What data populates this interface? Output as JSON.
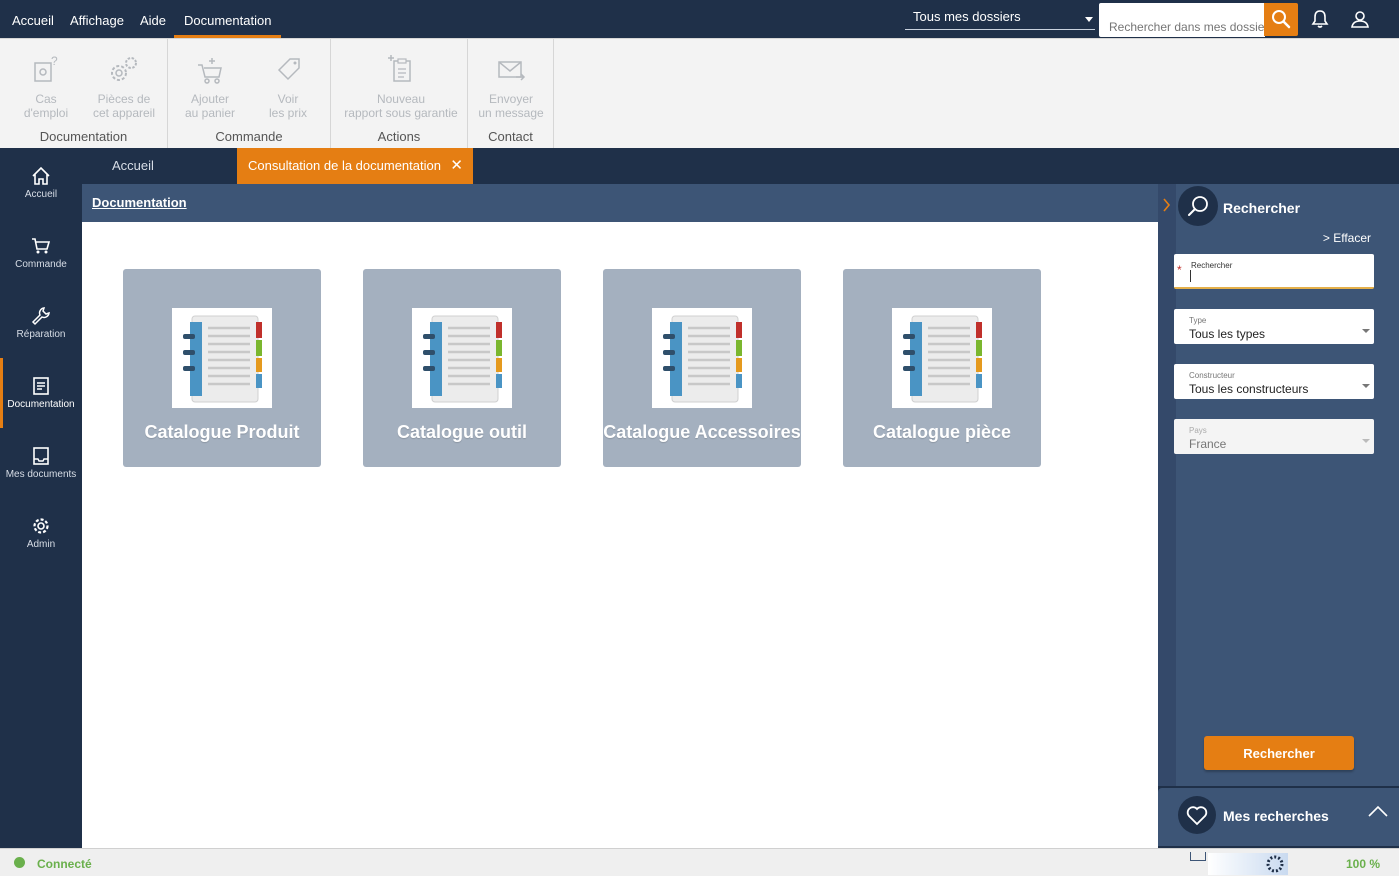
{
  "menu": {
    "items": [
      {
        "label": "Accueil"
      },
      {
        "label": "Affichage"
      },
      {
        "label": "Aide"
      },
      {
        "label": "Documentation"
      }
    ],
    "dossier_select": "Tous mes dossiers",
    "search_placeholder": "Rechercher dans mes dossiers"
  },
  "ribbon": {
    "groups": [
      {
        "label": "Documentation",
        "buttons": [
          {
            "line1": "Cas",
            "line2": "d'emploi"
          },
          {
            "line1": "Pièces de",
            "line2": "cet appareil"
          }
        ]
      },
      {
        "label": "Commande",
        "buttons": [
          {
            "line1": "Ajouter",
            "line2": "au panier"
          },
          {
            "line1": "Voir",
            "line2": "les prix"
          }
        ]
      },
      {
        "label": "Actions",
        "buttons": [
          {
            "line1": "Nouveau",
            "line2": "rapport sous garantie"
          }
        ]
      },
      {
        "label": "Contact",
        "buttons": [
          {
            "line1": "Envoyer",
            "line2": "un message"
          }
        ]
      }
    ]
  },
  "sidebar": {
    "items": [
      {
        "label": "Accueil"
      },
      {
        "label": "Commande"
      },
      {
        "label": "Réparation"
      },
      {
        "label": "Documentation"
      },
      {
        "label": "Mes documents"
      },
      {
        "label": "Admin"
      }
    ]
  },
  "tabs": [
    {
      "label": "Accueil"
    },
    {
      "label": "Consultation de la documentation"
    }
  ],
  "content": {
    "title": "Documentation",
    "cards": [
      {
        "label": "Catalogue Produit"
      },
      {
        "label": "Catalogue outil"
      },
      {
        "label": "Catalogue Accessoires"
      },
      {
        "label": "Catalogue pièce"
      }
    ]
  },
  "search_panel": {
    "title": "Rechercher",
    "clear": "> Effacer",
    "fields": [
      {
        "label": "Rechercher",
        "value": ""
      },
      {
        "label": "Type",
        "value": "Tous les types"
      },
      {
        "label": "Constructeur",
        "value": "Tous les constructeurs"
      },
      {
        "label": "Pays",
        "value": "France"
      }
    ],
    "button": "Rechercher"
  },
  "saved": {
    "title": "Mes recherches"
  },
  "status": {
    "connection": "Connecté",
    "zoom": "100 %"
  },
  "colors": {
    "accent": "#e57e13",
    "navy": "#1f3049",
    "panel": "#3d5576",
    "card": "#a4b0bf",
    "connected": "#6ab04c"
  }
}
